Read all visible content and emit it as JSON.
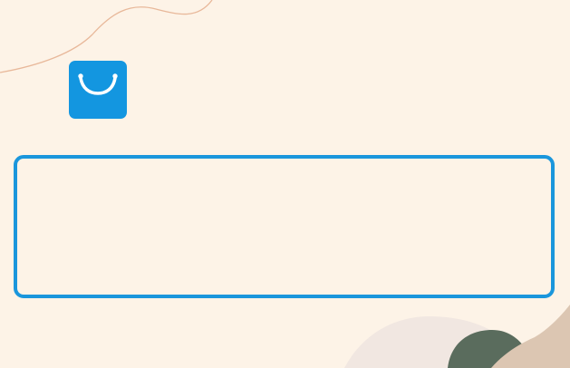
{
  "colors": {
    "background": "#fdf3e7",
    "accent": "#1396e0",
    "icon_glyph": "#ffffff",
    "box_border": "#1a96dc",
    "squiggle": "#e8b89a",
    "blob_light": "#f1e7e1",
    "blob_green": "#5a6c5d",
    "blob_tan": "#dcc6b2"
  },
  "app_icon": {
    "name": "shopping-bag-icon"
  },
  "text_box": {
    "value": ""
  }
}
